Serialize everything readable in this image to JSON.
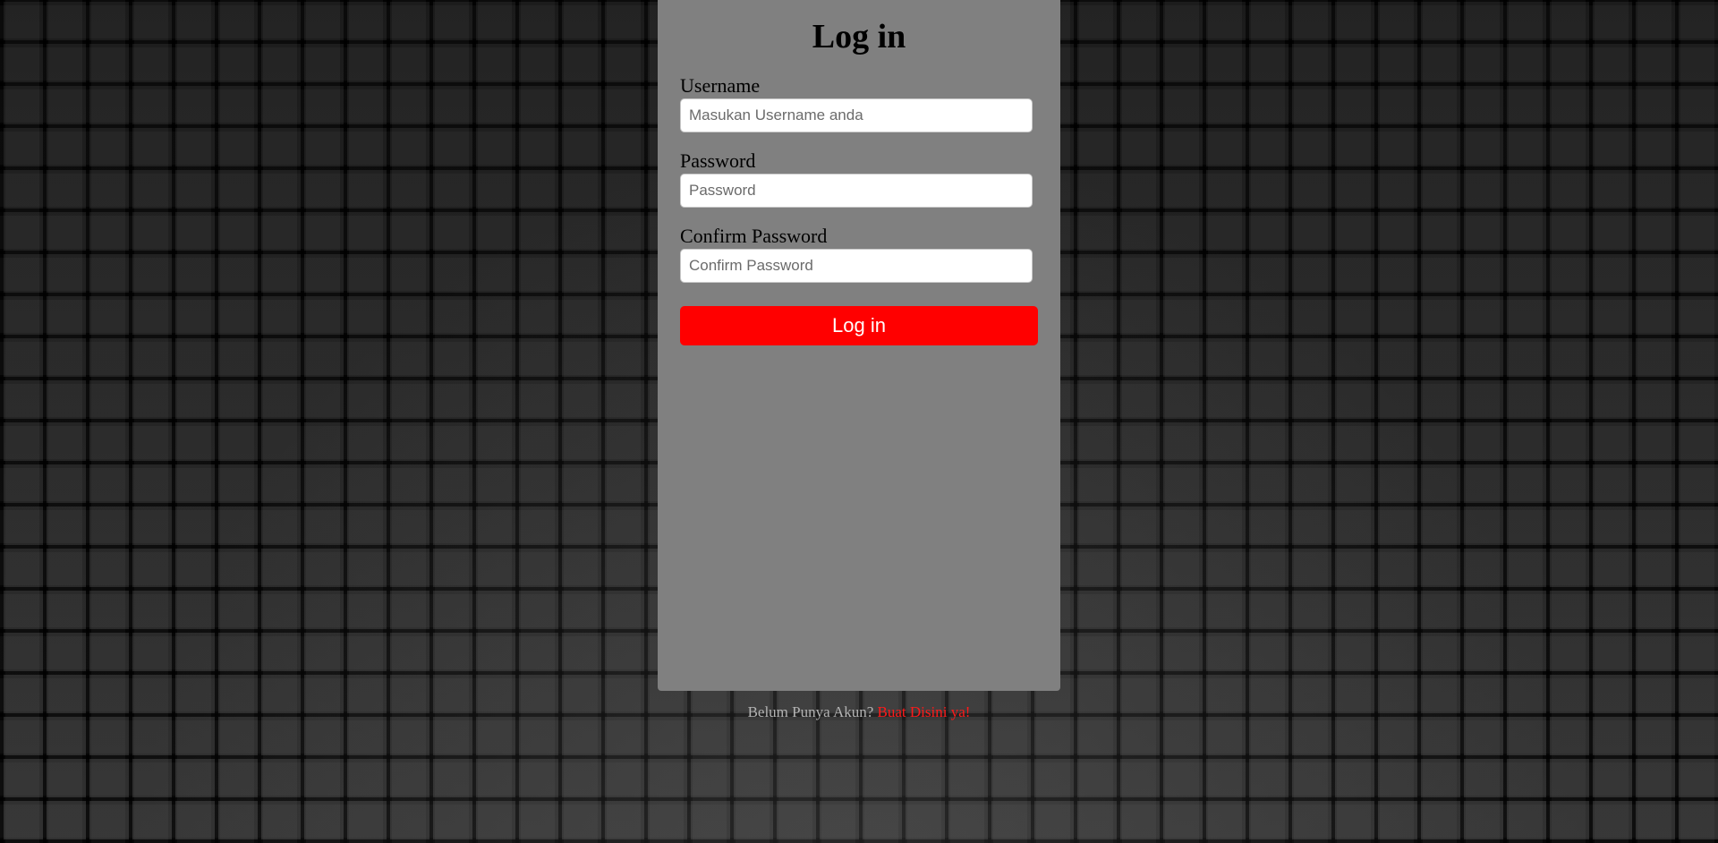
{
  "login_form": {
    "title": "Log in",
    "fields": [
      {
        "label": "Username",
        "value": "",
        "placeholder": "Masukan Username anda",
        "type": "text"
      },
      {
        "label": "Password",
        "value": "",
        "placeholder": "Password",
        "type": "password"
      },
      {
        "label": "Confirm Password",
        "value": "",
        "placeholder": "Confirm Password",
        "type": "password"
      }
    ],
    "submit_label": "Log in"
  },
  "footer": {
    "prompt": "Belum Punya Akun?",
    "link_text": "Buat Disini ya!"
  },
  "colors": {
    "card_background": "#808080",
    "accent": "#ff0000",
    "link": "#ff1a1a",
    "page_background": "#0b0b0b"
  }
}
